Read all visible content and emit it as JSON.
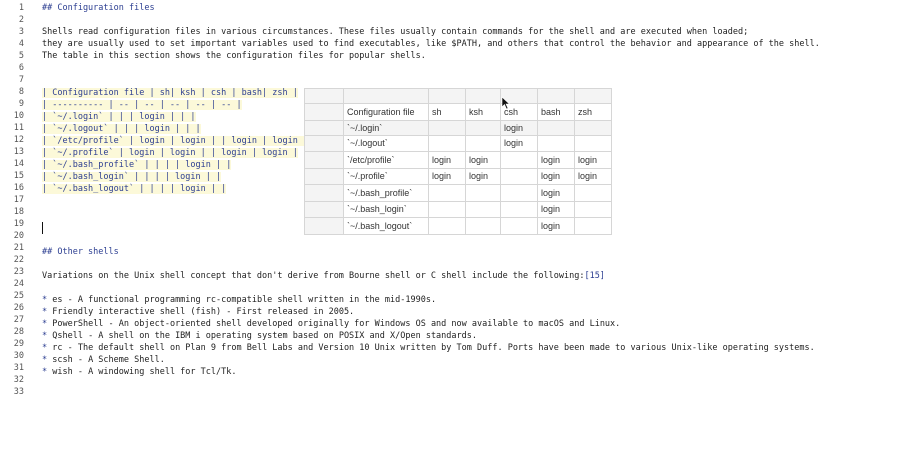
{
  "line_numbers": [
    "1",
    "2",
    "3",
    "4",
    "5",
    "6",
    "7",
    "8",
    "9",
    "10",
    "11",
    "12",
    "13",
    "14",
    "15",
    "16",
    "17",
    "18",
    "19",
    "20",
    "21",
    "22",
    "23",
    "24",
    "25",
    "26",
    "27",
    "28",
    "29",
    "30",
    "31",
    "32",
    "33"
  ],
  "heading1": "## Configuration files",
  "para1": [
    "Shells read configuration files in various circumstances. These files usually contain commands for the shell and are executed when loaded;",
    "they are usually used to set important variables used to find executables, like $PATH, and others that control the behavior and appearance of the shell.",
    "The table in this section shows the configuration files for popular shells."
  ],
  "table_source": [
    "| Configuration file | sh| ksh | csh | bash| zsh |",
    "| ---------- | -- | -- | -- | -- | -- |",
    "| `~/.login` | | | login | | |",
    "| `~/.logout` | | | login | | |",
    "| `/etc/profile` | login | login | | login | login |",
    "| `~/.profile` | login | login | | login | login |",
    "| `~/.bash_profile` | | | | login | |",
    "| `~/.bash_login` | | | | login | |",
    "| `~/.bash_logout` | | | | login | |"
  ],
  "heading2": "## Other shells",
  "para2": "Variations on the Unix shell concept that don't derive from Bourne shell or C shell include the following:",
  "para2_ref": "[15]",
  "bullets": [
    "es - A functional programming rc-compatible shell written in the mid-1990s.",
    "Friendly interactive shell (fish) - First released in 2005.",
    "PowerShell - An object-oriented shell developed originally for Windows OS and now available to macOS and Linux.",
    "Qshell - A shell on the IBM i operating system based on POSIX and X/Open standards.",
    "rc - The default shell on Plan 9 from Bell Labs and Version 10 Unix written by Tom Duff. Ports have been made to various Unix-like operating systems.",
    "scsh - A Scheme Shell.",
    "wish - A windowing shell for Tcl/Tk."
  ],
  "bullet_marker": "*",
  "rendered_table": {
    "header": [
      "Configuration file",
      "sh",
      "ksh",
      "csh",
      "bash",
      "zsh"
    ],
    "rows": [
      [
        "`~/.login`",
        "",
        "",
        "login",
        "",
        ""
      ],
      [
        "`~/.logout`",
        "",
        "",
        "login",
        "",
        ""
      ],
      [
        "`/etc/profile`",
        "login",
        "login",
        "",
        "login",
        "login"
      ],
      [
        "`~/.profile`",
        "login",
        "login",
        "",
        "login",
        "login"
      ],
      [
        "`~/.bash_profile`",
        "",
        "",
        "",
        "login",
        ""
      ],
      [
        "`~/.bash_login`",
        "",
        "",
        "",
        "login",
        ""
      ],
      [
        "`~/.bash_logout`",
        "",
        "",
        "",
        "login",
        ""
      ]
    ]
  },
  "colors": {
    "heading": "#2c3e91",
    "table_highlight": "#fcf9d9",
    "grid": "#d6d6d6"
  },
  "mouse_cursor_icon": "arrow-pointer-icon"
}
